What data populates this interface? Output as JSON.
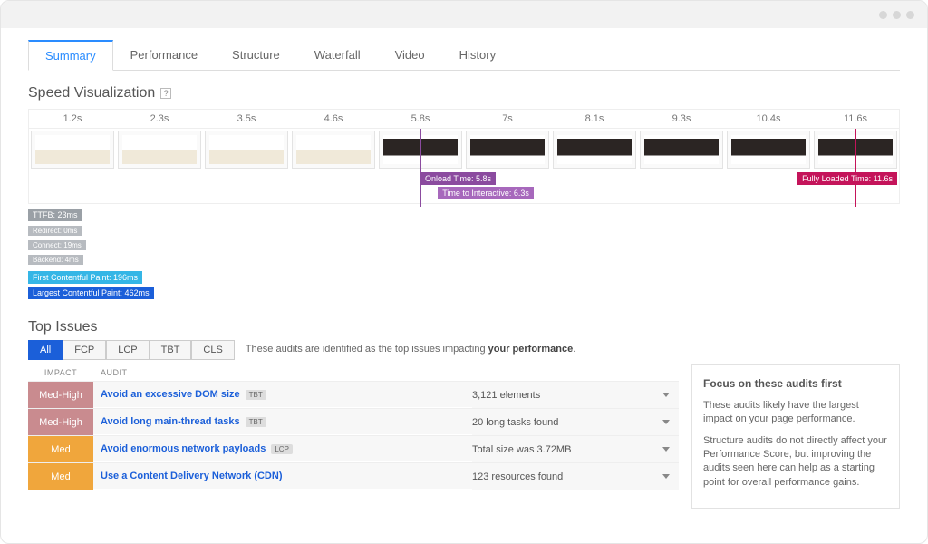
{
  "tabs": [
    "Summary",
    "Performance",
    "Structure",
    "Waterfall",
    "Video",
    "History"
  ],
  "active_tab_index": 0,
  "speed_vis": {
    "title": "Speed Visualization",
    "times": [
      "1.2s",
      "2.3s",
      "3.5s",
      "4.6s",
      "5.8s",
      "7s",
      "8.1s",
      "9.3s",
      "10.4s",
      "11.6s"
    ],
    "hero_start_index": 4,
    "badges": {
      "ttfb": "TTFB: 23ms",
      "redirect": "Redirect: 0ms",
      "connect": "Connect: 19ms",
      "backend": "Backend: 4ms",
      "fcp": "First Contentful Paint: 196ms",
      "lcp": "Largest Contentful Paint: 462ms"
    },
    "markers": {
      "onload": "Onload Time: 5.8s",
      "tti": "Time to Interactive: 6.3s",
      "full": "Fully Loaded Time: 11.6s"
    }
  },
  "top_issues": {
    "title": "Top Issues",
    "filters": [
      "All",
      "FCP",
      "LCP",
      "TBT",
      "CLS"
    ],
    "active_filter_index": 0,
    "filter_text_prefix": "These audits are identified as the top issues impacting ",
    "filter_text_bold": "your performance",
    "headers": {
      "impact": "Impact",
      "audit": "Audit"
    },
    "rows": [
      {
        "impact": "Med-High",
        "impact_class": "impact-medhigh",
        "audit": "Avoid an excessive DOM size",
        "tag": "TBT",
        "metric": "3,121 elements"
      },
      {
        "impact": "Med-High",
        "impact_class": "impact-medhigh",
        "audit": "Avoid long main-thread tasks",
        "tag": "TBT",
        "metric": "20 long tasks found"
      },
      {
        "impact": "Med",
        "impact_class": "impact-med",
        "audit": "Avoid enormous network payloads",
        "tag": "LCP",
        "metric": "Total size was 3.72MB"
      },
      {
        "impact": "Med",
        "impact_class": "impact-med",
        "audit": "Use a Content Delivery Network (CDN)",
        "tag": "",
        "metric": "123 resources found"
      }
    ],
    "side": {
      "title": "Focus on these audits first",
      "p1": "These audits likely have the largest impact on your page performance.",
      "p2": "Structure audits do not directly affect your Performance Score, but improving the audits seen here can help as a starting point for overall performance gains."
    }
  }
}
